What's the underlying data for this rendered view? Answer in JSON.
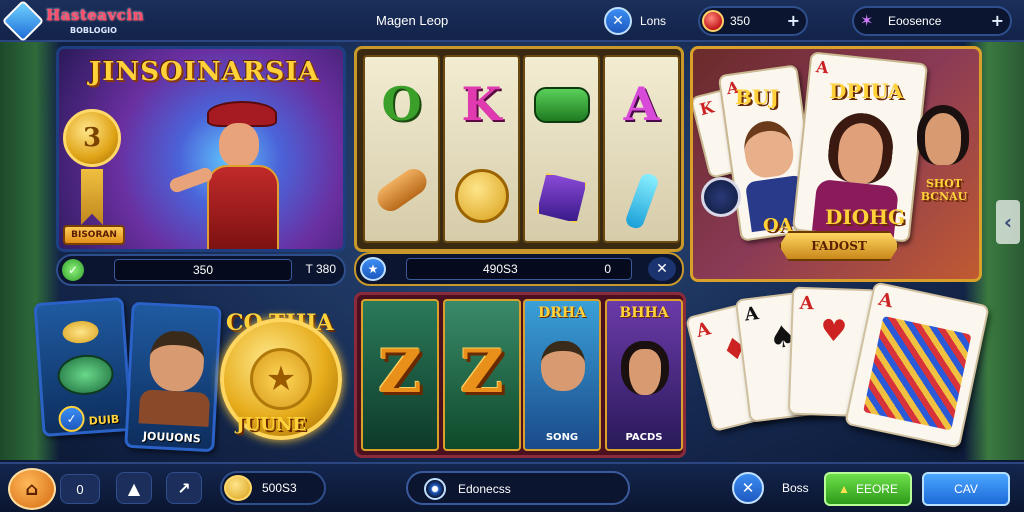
{
  "topbar": {
    "logo_title": "Hasteavcin",
    "logo_sub": "BOBLOGIO",
    "title": "Magen Leop",
    "tools_label": "Lons",
    "gems_value": "350",
    "gems_plus": "+",
    "resource_label": "Eoosence",
    "resource_plus": "+"
  },
  "hero": {
    "title": "JINSOINARSIA",
    "badge_number": "3",
    "tag_label": "BISORAN",
    "bar_value": "350",
    "bar_right": "T 380"
  },
  "reels": {
    "symbols": [
      "O",
      "K",
      "",
      "A"
    ],
    "bar_left": "490S3",
    "bar_right": "0"
  },
  "cards_panel": {
    "title_left": "BUJ",
    "title_center": "DPIUA",
    "title_right": "SHOT BCNAU",
    "footer_left": "OA",
    "footer_center": "DIOHG",
    "banner": "FADOST"
  },
  "mini_cards": {
    "left_label": "DUIB",
    "right_label": "JOUUONS"
  },
  "coin": {
    "text_top": "CO-THIA",
    "text_bottom": "JUUNE"
  },
  "slots2": {
    "panels": [
      {
        "big": "Z",
        "title": "",
        "label": ""
      },
      {
        "big": "Z",
        "title": "",
        "label": ""
      },
      {
        "big": "",
        "title": "DRHA",
        "label": "SONG"
      },
      {
        "big": "",
        "title": "BHHA",
        "label": "PACDS"
      }
    ]
  },
  "fan_cards": [
    "A",
    "A",
    "A",
    "A"
  ],
  "bottombar": {
    "count": "0",
    "coins": "500S3",
    "search_text": "Edonecss",
    "boss_label": "Boss",
    "green_label": "EEORE",
    "blue_label": "CAV"
  },
  "colors": {
    "accent_gold": "#ffd23a",
    "primary_blue": "#1d59c0",
    "green_button": "#2e9a1a"
  }
}
